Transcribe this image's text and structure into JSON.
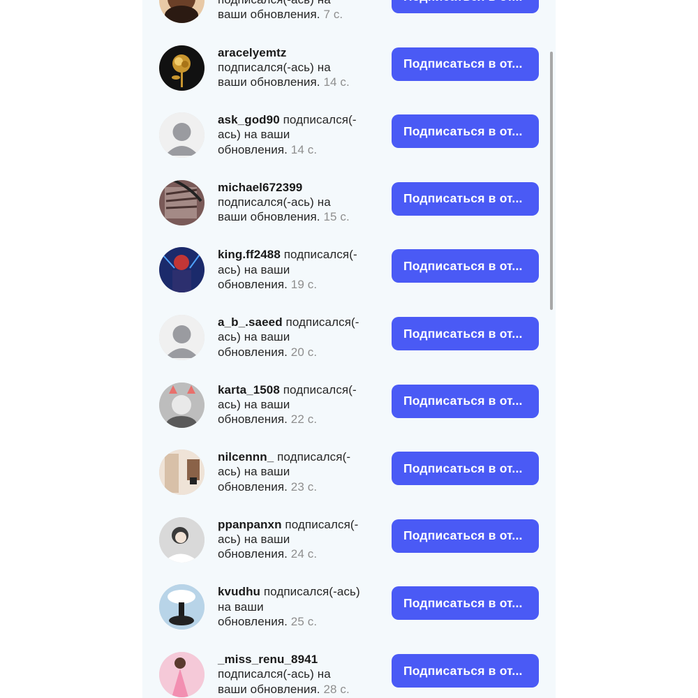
{
  "notifications": [
    {
      "username": "",
      "line_user": "",
      "line1": "подписался(-ась) на",
      "line2": "ваши обновления.",
      "time": "7 с.",
      "button": "Подписаться в от...",
      "avatar": "woman-portrait-avatar"
    },
    {
      "username": "aracelyemtz",
      "line_user": "",
      "line1": "подписался(-ась) на",
      "line2": "ваши обновления.",
      "time": "14 с.",
      "button": "Подписаться в от...",
      "avatar": "golden-rose-avatar"
    },
    {
      "username": "ask_god90",
      "line_user": "подписался(-",
      "line1": "ась) на ваши",
      "line2": "обновления.",
      "time": "14 с.",
      "button": "Подписаться в от...",
      "avatar": "default-user-avatar"
    },
    {
      "username": "michael672399",
      "line_user": "",
      "line1": "подписался(-ась) на",
      "line2": "ваши обновления.",
      "time": "15 с.",
      "button": "Подписаться в от...",
      "avatar": "stairs-photo-avatar"
    },
    {
      "username": "king.ff2488",
      "line_user": "подписался(-",
      "line1": "ась) на ваши",
      "line2": "обновления.",
      "time": "19 с.",
      "button": "Подписаться в от...",
      "avatar": "game-character-avatar"
    },
    {
      "username": "a_b_.saeed",
      "line_user": "подписался(-",
      "line1": "ась) на ваши",
      "line2": "обновления.",
      "time": "20 с.",
      "button": "Подписаться в от...",
      "avatar": "default-user-avatar"
    },
    {
      "username": "karta_1508",
      "line_user": "подписался(-",
      "line1": "ась) на ваши",
      "line2": "обновления.",
      "time": "22 с.",
      "button": "Подписаться в от...",
      "avatar": "girl-cat-ears-avatar"
    },
    {
      "username": "nilcennn_",
      "line_user": "подписался(-",
      "line1": "ась) на ваши",
      "line2": "обновления.",
      "time": "23 с.",
      "button": "Подписаться в от...",
      "avatar": "room-door-avatar"
    },
    {
      "username": "ppanpanxn",
      "line_user": "подписался(-",
      "line1": "ась) на ваши",
      "line2": "обновления.",
      "time": "24 с.",
      "button": "Подписаться в от...",
      "avatar": "girl-smiling-avatar"
    },
    {
      "username": "kvudhu",
      "line_user": "подписался(-ась)",
      "line1": "на ваши",
      "line2": "обновления.",
      "time": "25 с.",
      "button": "Подписаться в от...",
      "avatar": "sky-silhouette-avatar"
    },
    {
      "username": "_miss_renu_8941",
      "line_user": "",
      "line1": "подписался(-ась) на",
      "line2": "ваши обновления.",
      "time": "28 с.",
      "button": "Подписаться в от...",
      "avatar": "pink-dress-avatar"
    }
  ],
  "colors": {
    "panel_bg": "#f4f9fc",
    "button_bg": "#4a5af5",
    "button_text": "#ffffff",
    "username_text": "#1a1a1a",
    "body_text": "#262626",
    "time_text": "#8e8e8e"
  }
}
